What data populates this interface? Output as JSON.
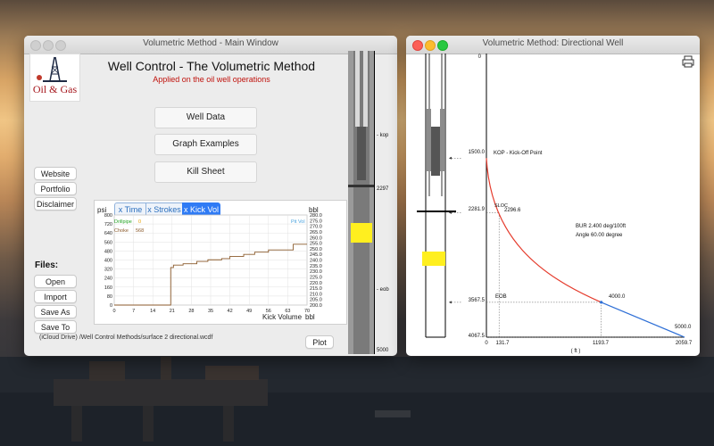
{
  "main_window": {
    "title": "Volumetric Method - Main Window",
    "heading": "Well Control - The Volumetric Method",
    "subheading": "Applied on the oil well operations",
    "logo_text": "Oil & Gas",
    "nav_buttons": [
      "Well Data",
      "Graph Examples",
      "Kill Sheet"
    ],
    "side_links": [
      "Website",
      "Portfolio",
      "Disclaimer"
    ],
    "files_label": "Files:",
    "file_buttons": [
      "Open",
      "Import",
      "Save As",
      "Save To"
    ],
    "file_path": "(iCloud Drive) /Well Control Methods/surface 2 directional.wcdf",
    "plot_button": "Plot",
    "segments": [
      "x Time",
      "x Strokes",
      "x Kick Vol"
    ],
    "selected_segment": "x Kick Vol",
    "well_labels": {
      "kop": "- kop",
      "eob": "- eob",
      "depth_top": "2297",
      "depth_bottom": "5000"
    },
    "chart_text": {
      "psi": "psi",
      "bbl": "bbl",
      "xlabel": "Kick Volume",
      "xunit": "bbl",
      "legend_drillpipe": "Drillpipe",
      "legend_drillpipe_val": "0",
      "legend_choke": "Choke",
      "legend_choke_val": "568",
      "legend_pitvol": "Pit Vol"
    }
  },
  "chart_data": {
    "type": "line",
    "xlabel": "Kick Volume",
    "xunit": "bbl",
    "ylabel_left": "psi",
    "ylabel_right": "bbl",
    "x_ticks": [
      0,
      7,
      14,
      21,
      28,
      35,
      42,
      49,
      56,
      63,
      70
    ],
    "y_left_ticks": [
      0,
      80,
      160,
      240,
      320,
      400,
      480,
      560,
      640,
      720,
      800
    ],
    "y_right_ticks": [
      200.0,
      205.0,
      210.0,
      215.0,
      220.0,
      225.0,
      230.0,
      235.0,
      240.0,
      245.0,
      250.0,
      255.0,
      260.0,
      265.0,
      270.0,
      275.0,
      280.0
    ],
    "xlim": [
      0,
      70
    ],
    "ylim_left": [
      0,
      800
    ],
    "ylim_right": [
      200,
      280
    ],
    "series": [
      {
        "name": "Choke",
        "color": "#8b5a2b",
        "x": [
          0,
          20.5,
          20.5,
          21.5,
          21.5,
          25,
          25,
          30,
          30,
          34,
          34,
          39,
          39,
          42,
          42,
          47,
          47,
          51,
          51,
          56,
          56,
          65,
          65,
          70
        ],
        "y": [
          0,
          0,
          333,
          333,
          355,
          355,
          367,
          367,
          388,
          388,
          402,
          402,
          412,
          412,
          432,
          432,
          450,
          450,
          470,
          470,
          490,
          490,
          540,
          540
        ]
      }
    ]
  },
  "directional_window": {
    "title": "Volumetric Method: Directional Well",
    "depth_labels": [
      "0",
      "1500.0",
      "2281.9",
      "3567.5",
      "4067.5"
    ],
    "x_labels": [
      "0",
      "131.7",
      "1193.7",
      "2059.7"
    ],
    "x_unit": "( ft )",
    "annotations": {
      "kop": "KOP - Kick-Off Point",
      "sloc": "SLOC",
      "sloc_value": "2296.6",
      "eob": "EOB",
      "md1": "4000.0",
      "md2": "5000.0",
      "bur": "BUR 2.400 deg/100ft",
      "angle": "Angle 60.00 degree"
    },
    "trajectory": {
      "vertical_depth": [
        0,
        1500
      ],
      "build_section": {
        "kop_tvd": 1500,
        "eob_tvd": 3567.5,
        "eob_hd": 1193.7,
        "color": "#e53b2c"
      },
      "tangent_section": {
        "start_tvd": 3567.5,
        "start_hd": 1193.7,
        "end_tvd": 4067.5,
        "end_hd": 2059.7,
        "color": "#2e6fd6"
      },
      "sloc_hd": 131.7,
      "sloc_tvd": 2281.9,
      "max_tvd": 4067.5,
      "max_hd": 2059.7
    }
  }
}
